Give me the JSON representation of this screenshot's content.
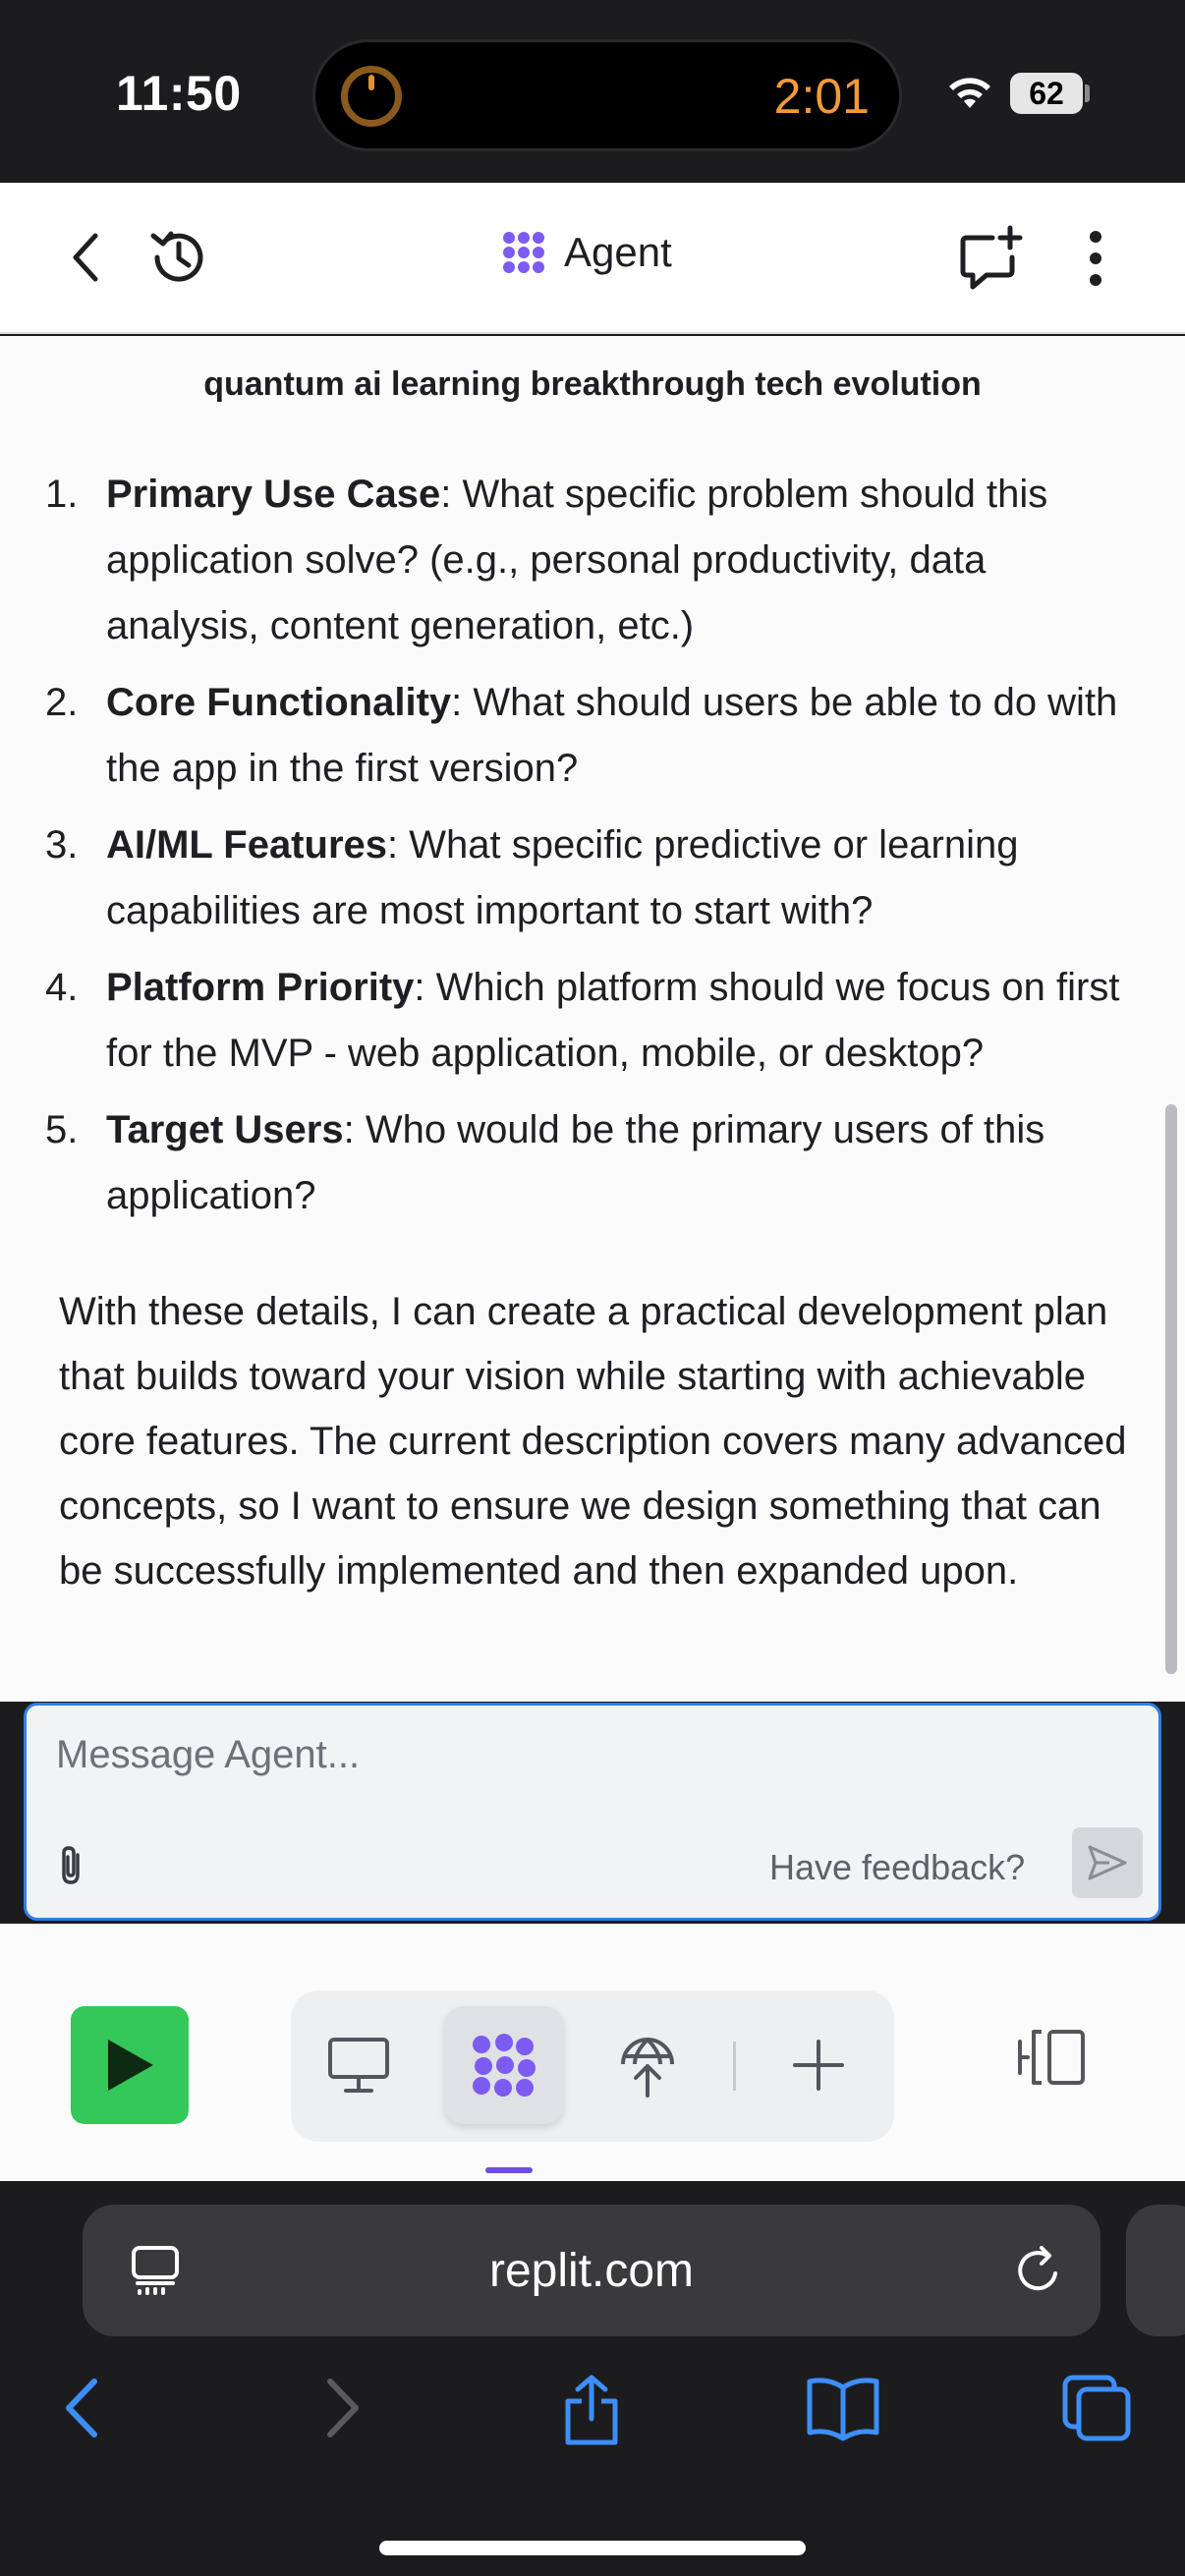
{
  "status_bar": {
    "time": "11:50",
    "island_timer": "2:01",
    "battery": "62"
  },
  "header": {
    "title": "Agent"
  },
  "chat": {
    "top_line": "quantum ai learning breakthrough tech evolution",
    "questions": [
      {
        "num": "1.",
        "title": "Primary Use Case",
        "text": ": What specific problem should this application solve? (e.g., personal productivity, data analysis, content generation, etc.)"
      },
      {
        "num": "2.",
        "title": "Core Functionality",
        "text": ": What should users be able to do with the app in the first version?"
      },
      {
        "num": "3.",
        "title": "AI/ML Features",
        "text": ": What specific predictive or learning capabilities are most important to start with?"
      },
      {
        "num": "4.",
        "title": "Platform Priority",
        "text": ": Which platform should we focus on first for the MVP - web application, mobile, or desktop?"
      },
      {
        "num": "5.",
        "title": "Target Users",
        "text": ": Who would be the primary users of this application?"
      }
    ],
    "closing_paragraph": "With these details, I can create a practical development plan that builds toward your vision while starting with achievable core features. The current description covers many advanced concepts, so I want to ensure we design something that can be successfully implemented and then expanded upon."
  },
  "composer": {
    "placeholder": "Message Agent...",
    "feedback_label": "Have feedback?"
  },
  "safari": {
    "url": "replit.com"
  },
  "colors": {
    "accent": "#2f7ee6",
    "agent_purple": "#7c5cf0",
    "run_green": "#34c759",
    "safari_blue": "#3e8ef7"
  }
}
